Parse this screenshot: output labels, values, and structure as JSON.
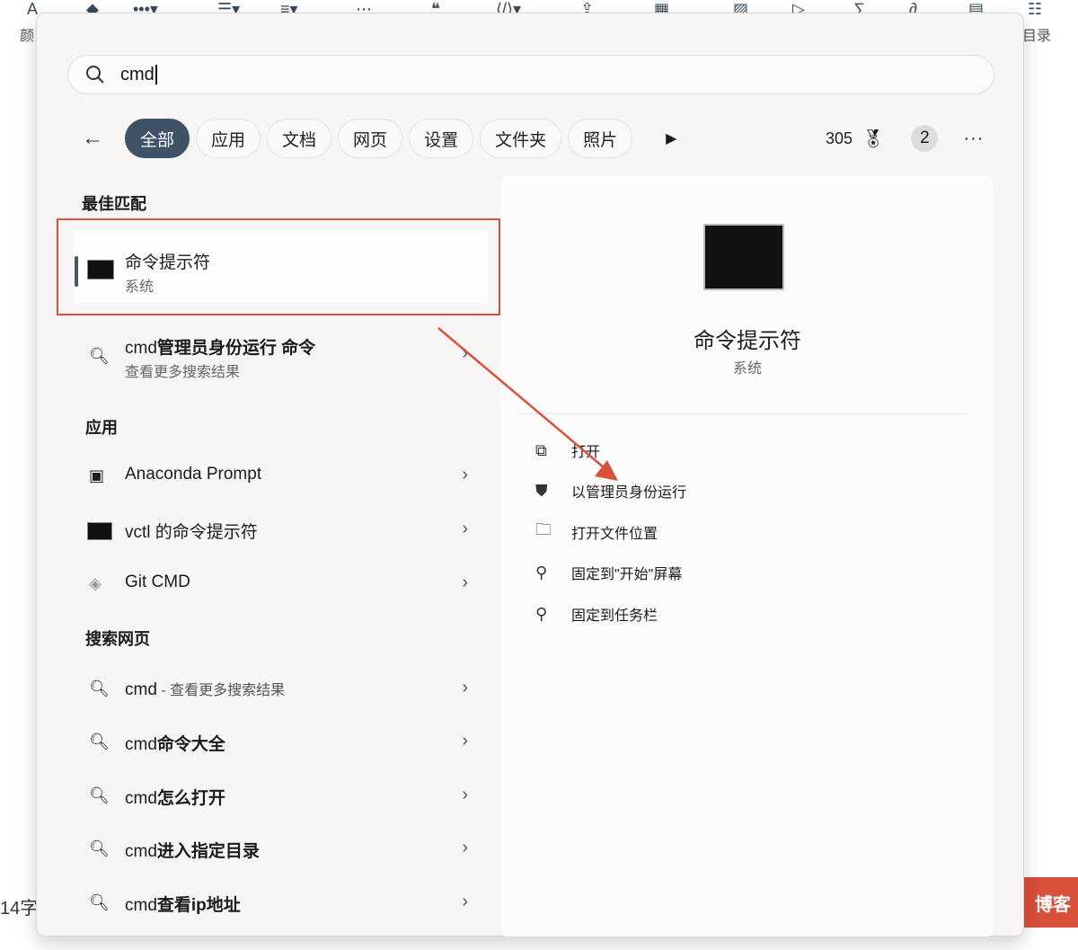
{
  "background": {
    "toolbar_left_label": "颜",
    "toolbar_right_label": "目录",
    "bottom_left_text": "14字",
    "blog_button": "博客",
    "toolbar_icons": [
      "font-color-icon",
      "highlight-icon",
      "more-icon",
      "list-icon",
      "align-icon",
      "divider-icon",
      "quote-icon",
      "code-icon",
      "upload-icon",
      "table-icon",
      "image-icon",
      "video-icon",
      "formula-icon",
      "link-icon",
      "template-icon",
      "toc-icon"
    ]
  },
  "search": {
    "value": "cmd"
  },
  "filters": {
    "items": [
      "全部",
      "应用",
      "文档",
      "网页",
      "设置",
      "文件夹",
      "照片"
    ],
    "active": "全部"
  },
  "tools": {
    "points": "305",
    "badge": "2",
    "more": "···"
  },
  "best_match": {
    "heading": "最佳匹配",
    "title": "命令提示符",
    "subtitle": "系统"
  },
  "suggestion": {
    "prefix": "cmd",
    "bold": "管理员身份运行 命令",
    "subtitle": "查看更多搜索结果"
  },
  "apps": {
    "heading": "应用",
    "items": [
      "Anaconda Prompt",
      "vctl 的命令提示符",
      "Git CMD"
    ]
  },
  "web": {
    "heading": "搜索网页",
    "first": {
      "prefix": "cmd",
      "suffix": " - 查看更多搜索结果"
    },
    "items": [
      {
        "prefix": "cmd",
        "bold": "命令大全"
      },
      {
        "prefix": "cmd",
        "bold": "怎么打开"
      },
      {
        "prefix": "cmd",
        "bold": "进入指定目录"
      },
      {
        "prefix": "cmd",
        "bold": "查看ip地址"
      }
    ]
  },
  "preview": {
    "title": "命令提示符",
    "subtitle": "系统",
    "actions": [
      "打开",
      "以管理员身份运行",
      "打开文件位置",
      "固定到\"开始\"屏幕",
      "固定到任务栏"
    ]
  },
  "colors": {
    "accent": "#3f5266",
    "annotation": "#d9503b"
  }
}
